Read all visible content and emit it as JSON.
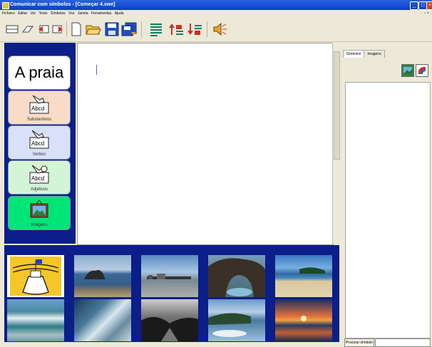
{
  "window": {
    "title": "Comunicar com símbolos - [Começar 4.swe]"
  },
  "menu": [
    "Ficheiro",
    "Editar",
    "Ver",
    "Texto",
    "Símbolos",
    "Voz",
    "Janela",
    "Ferramentas",
    "Ajuda"
  ],
  "symbols": {
    "word": "A praia",
    "substantivos": "Substantivos",
    "verbos": "Verbos",
    "adjetivos": "Adjetivos",
    "imagens": "Imagens"
  },
  "right_panel": {
    "tabs": [
      "Símbolos",
      "Imagens"
    ],
    "search_button": "Procurar símbolo"
  },
  "colors": {
    "panel_blue": "#0b1e8a",
    "substantivos_bg": "#f8dcc8",
    "verbos_bg": "#d8e0fa",
    "adjetivos_bg": "#d4f4d8",
    "imagens_bg": "#00e676"
  },
  "images": [
    "sandcastle-clipart",
    "rocky-islet-sea",
    "pier-dock",
    "rock-arch",
    "sandy-beach",
    "breaking-wave",
    "surf-shore",
    "dark-sea-rocks",
    "coastal-cove",
    "sunset-sea"
  ]
}
